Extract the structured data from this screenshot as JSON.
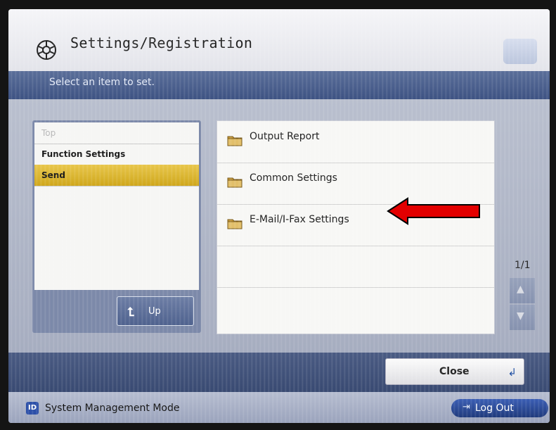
{
  "header": {
    "title": "Settings/Registration",
    "instruction": "Select an item to set."
  },
  "breadcrumb": {
    "items": [
      "Top",
      "Function Settings",
      "Send"
    ]
  },
  "up_button": {
    "label": "Up"
  },
  "list": {
    "items": [
      "Output Report",
      "Common Settings",
      "E-Mail/I-Fax Settings"
    ],
    "page": "1/1"
  },
  "footer": {
    "close_label": "Close"
  },
  "status": {
    "id_badge": "ID",
    "mode": "System Management Mode",
    "logout_label": "Log Out"
  },
  "icons": {
    "title": "settings-gear-icon",
    "folder": "folder-icon",
    "up": "up-arrow-icon",
    "close": "return-icon",
    "logout": "logout-icon",
    "highlight": "red-arrow-icon"
  },
  "colors": {
    "selected_crumb": "#d4ad22",
    "instruction_bar": "#4a5e8c",
    "highlight_arrow": "#e30000"
  }
}
